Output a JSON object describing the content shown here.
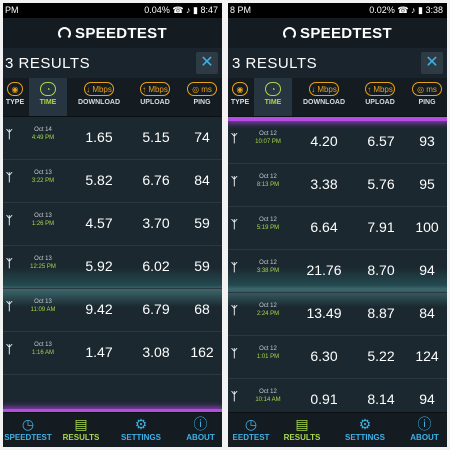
{
  "colors": {
    "accent_green": "#a8d84b",
    "accent_blue": "#3fb0e6",
    "accent_orange": "#e7a21d",
    "glow_purple": "#b44de0"
  },
  "left": {
    "status": {
      "time": "PM",
      "extra": "",
      "right": "0.04% ☎ ♪ ▮ 8:47"
    },
    "app_title": "SPEEDTEST",
    "results_title": "3 RESULTS",
    "columns": [
      {
        "label": "TYPE",
        "icon": "type-icon",
        "glyph": "◉"
      },
      {
        "label": "TIME",
        "icon": "clock-icon",
        "glyph": "◔"
      },
      {
        "label": "DOWNLOAD",
        "icon": "download-icon",
        "glyph": "↓ Mbps"
      },
      {
        "label": "UPLOAD",
        "icon": "upload-icon",
        "glyph": "↑ Mbps"
      },
      {
        "label": "PING",
        "icon": "ping-icon",
        "glyph": "◎ ms"
      }
    ],
    "rows": [
      {
        "date": "Oct 14",
        "time": "4:49 PM",
        "download": "1.65",
        "upload": "5.15",
        "ping": "74"
      },
      {
        "date": "Oct 13",
        "time": "3:22 PM",
        "download": "5.82",
        "upload": "6.76",
        "ping": "84"
      },
      {
        "date": "Oct 13",
        "time": "1:26 PM",
        "download": "4.57",
        "upload": "3.70",
        "ping": "59"
      },
      {
        "date": "Oct 13",
        "time": "12:25 PM",
        "download": "5.92",
        "upload": "6.02",
        "ping": "59"
      },
      {
        "date": "Oct 13",
        "time": "11:09 AM",
        "download": "9.42",
        "upload": "6.79",
        "ping": "68"
      },
      {
        "date": "Oct 13",
        "time": "1:16 AM",
        "download": "1.47",
        "upload": "3.08",
        "ping": "162"
      }
    ],
    "nav": [
      {
        "label": "SPEEDTEST",
        "glyph": "◷",
        "icon": "speedtest-icon"
      },
      {
        "label": "RESULTS",
        "glyph": "▤",
        "icon": "results-icon"
      },
      {
        "label": "SETTINGS",
        "glyph": "⚙",
        "icon": "settings-icon"
      },
      {
        "label": "ABOUT",
        "glyph": "ⓘ",
        "icon": "about-icon"
      }
    ]
  },
  "right": {
    "status": {
      "time": "8 PM",
      "extra": "",
      "right": "0.02% ☎ ♪ ▮ 3:38"
    },
    "app_title": "SPEEDTEST",
    "results_title": "3 RESULTS",
    "columns": [
      {
        "label": "TYPE",
        "icon": "type-icon",
        "glyph": "◉"
      },
      {
        "label": "TIME",
        "icon": "clock-icon",
        "glyph": "◔"
      },
      {
        "label": "DOWNLOAD",
        "icon": "download-icon",
        "glyph": "↓ Mbps"
      },
      {
        "label": "UPLOAD",
        "icon": "upload-icon",
        "glyph": "↑ Mbps"
      },
      {
        "label": "PING",
        "icon": "ping-icon",
        "glyph": "◎ ms"
      }
    ],
    "rows": [
      {
        "date": "Oct 12",
        "time": "10:07 PM",
        "download": "4.20",
        "upload": "6.57",
        "ping": "93"
      },
      {
        "date": "Oct 12",
        "time": "8:13 PM",
        "download": "3.38",
        "upload": "5.76",
        "ping": "95"
      },
      {
        "date": "Oct 12",
        "time": "5:19 PM",
        "download": "6.64",
        "upload": "7.91",
        "ping": "100"
      },
      {
        "date": "Oct 12",
        "time": "3:38 PM",
        "download": "21.76",
        "upload": "8.70",
        "ping": "94"
      },
      {
        "date": "Oct 12",
        "time": "2:24 PM",
        "download": "13.49",
        "upload": "8.87",
        "ping": "84"
      },
      {
        "date": "Oct 12",
        "time": "1:01 PM",
        "download": "6.30",
        "upload": "5.22",
        "ping": "124"
      },
      {
        "date": "Oct 12",
        "time": "10:14 AM",
        "download": "0.91",
        "upload": "8.14",
        "ping": "94"
      }
    ],
    "nav": [
      {
        "label": "EEDTEST",
        "glyph": "◷",
        "icon": "speedtest-icon"
      },
      {
        "label": "RESULTS",
        "glyph": "▤",
        "icon": "results-icon"
      },
      {
        "label": "SETTINGS",
        "glyph": "⚙",
        "icon": "settings-icon"
      },
      {
        "label": "ABOUT",
        "glyph": "ⓘ",
        "icon": "about-icon"
      }
    ]
  }
}
